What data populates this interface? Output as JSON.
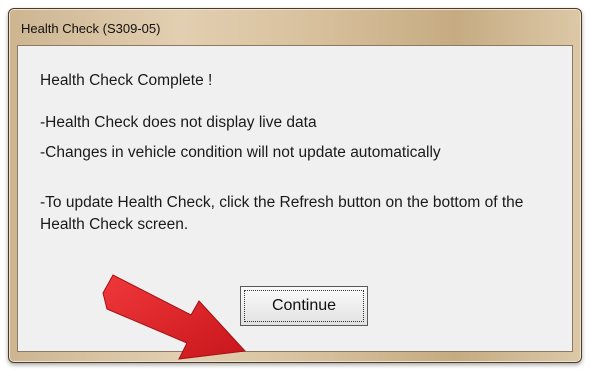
{
  "window": {
    "title": "Health Check (S309-05)"
  },
  "dialog": {
    "heading": "Health Check Complete !",
    "line1": "-Health Check does not display live data",
    "line2": "-Changes in vehicle condition will not update automatically",
    "line3": "-To update Health Check, click the Refresh button on the bottom of the Health Check screen.",
    "continue_label": "Continue"
  },
  "annotation": {
    "arrow_icon": "red-arrow-icon",
    "arrow_color": "#e0262a"
  },
  "colors": {
    "titlebar": "#d7bf9b",
    "client_background": "#f0f0f0"
  }
}
